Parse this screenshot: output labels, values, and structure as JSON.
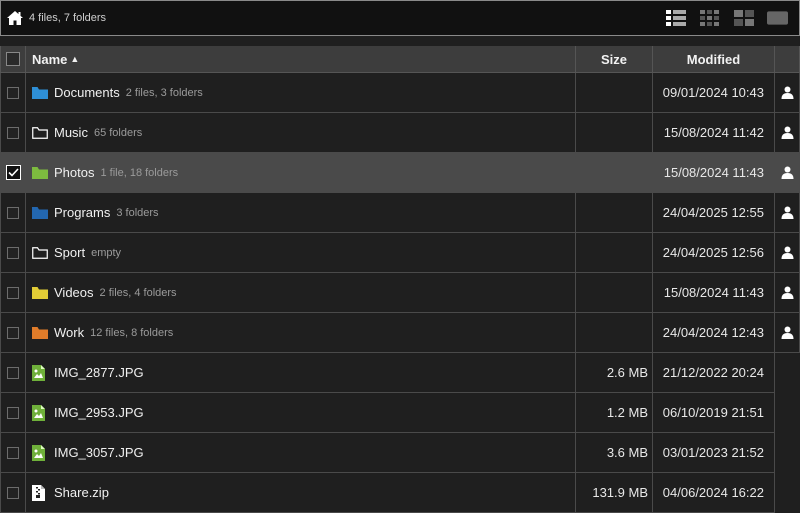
{
  "toolbar": {
    "summary": "4 files, 7 folders",
    "views": [
      "list-view-icon",
      "small-grid-view-icon",
      "large-grid-view-icon",
      "preview-view-icon"
    ]
  },
  "header": {
    "name": "Name",
    "size": "Size",
    "modified": "Modified",
    "sort_indicator": "▲"
  },
  "colors": {
    "folder_blue": "#2e8fd6",
    "folder_green": "#7dbb3f",
    "folder_darkblue": "#2367b0",
    "folder_yellow": "#e2cc36",
    "folder_orange": "#e07c2a",
    "file_green": "#6fb03a"
  },
  "rows": [
    {
      "name": "Documents",
      "meta": "2 files, 3 folders",
      "size": "",
      "modified": "09/01/2024 10:43",
      "icon": "folder-blue-icon",
      "selected": false
    },
    {
      "name": "Music",
      "meta": "65 folders",
      "size": "",
      "modified": "15/08/2024 11:42",
      "icon": "folder-outline-icon",
      "selected": false
    },
    {
      "name": "Photos",
      "meta": "1 file, 18 folders",
      "size": "",
      "modified": "15/08/2024 11:43",
      "icon": "folder-green-icon",
      "selected": true
    },
    {
      "name": "Programs",
      "meta": "3 folders",
      "size": "",
      "modified": "24/04/2025 12:55",
      "icon": "folder-darkblue-icon",
      "selected": false
    },
    {
      "name": "Sport",
      "meta": "empty",
      "size": "",
      "modified": "24/04/2025 12:56",
      "icon": "folder-outline-icon",
      "selected": false
    },
    {
      "name": "Videos",
      "meta": "2 files, 4 folders",
      "size": "",
      "modified": "15/08/2024 11:43",
      "icon": "folder-yellow-icon",
      "selected": false
    },
    {
      "name": "Work",
      "meta": "12 files, 8 folders",
      "size": "",
      "modified": "24/04/2024 12:43",
      "icon": "folder-orange-icon",
      "selected": false
    },
    {
      "name": "IMG_2877.JPG",
      "meta": "",
      "size": "2.6 MB",
      "modified": "21/12/2022 20:24",
      "icon": "image-file-icon",
      "selected": false
    },
    {
      "name": "IMG_2953.JPG",
      "meta": "",
      "size": "1.2 MB",
      "modified": "06/10/2019 21:51",
      "icon": "image-file-icon",
      "selected": false
    },
    {
      "name": "IMG_3057.JPG",
      "meta": "",
      "size": "3.6 MB",
      "modified": "03/01/2023 21:52",
      "icon": "image-file-icon",
      "selected": false
    },
    {
      "name": "Share.zip",
      "meta": "",
      "size": "131.9 MB",
      "modified": "04/06/2024 16:22",
      "icon": "zip-file-icon",
      "selected": false
    }
  ]
}
